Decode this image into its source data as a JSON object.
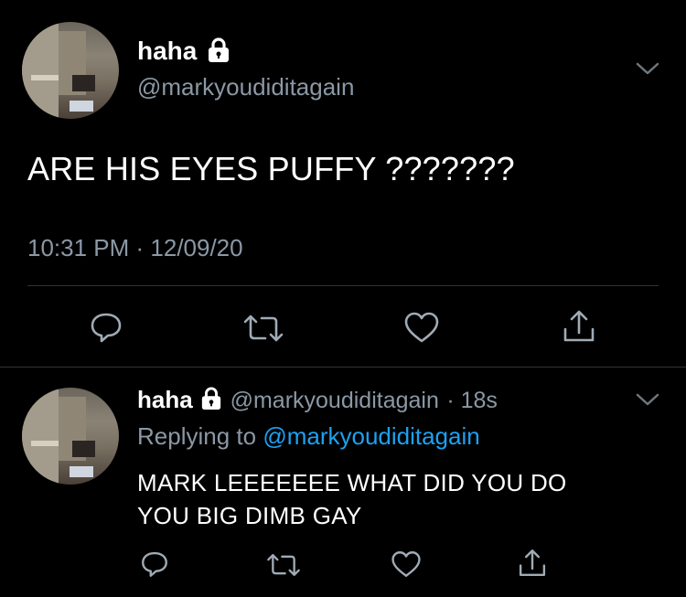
{
  "main_tweet": {
    "display_name": "haha",
    "handle": "@markyoudiditagain",
    "text": "ARE HIS EYES PUFFY ???????",
    "timestamp": "10:31 PM · 12/09/20",
    "icons": [
      "reply-icon",
      "retweet-icon",
      "like-icon",
      "share-icon"
    ]
  },
  "reply_tweet": {
    "display_name": "haha",
    "handle": "@markyoudiditagain",
    "time": "· 18s",
    "replying_prefix": "Replying to",
    "replying_handle": "@markyoudiditagain",
    "text_line1": "MARK LEEEEEEE WHAT DID YOU DO",
    "text_line2": "YOU BIG DIMB GAY",
    "icons": [
      "reply-icon",
      "retweet-icon",
      "like-icon",
      "share-icon"
    ]
  },
  "colors": {
    "background": "#000000",
    "text": "#ffffff",
    "muted": "#8b98a5",
    "link": "#1da1f2",
    "divider": "#2f3336"
  }
}
